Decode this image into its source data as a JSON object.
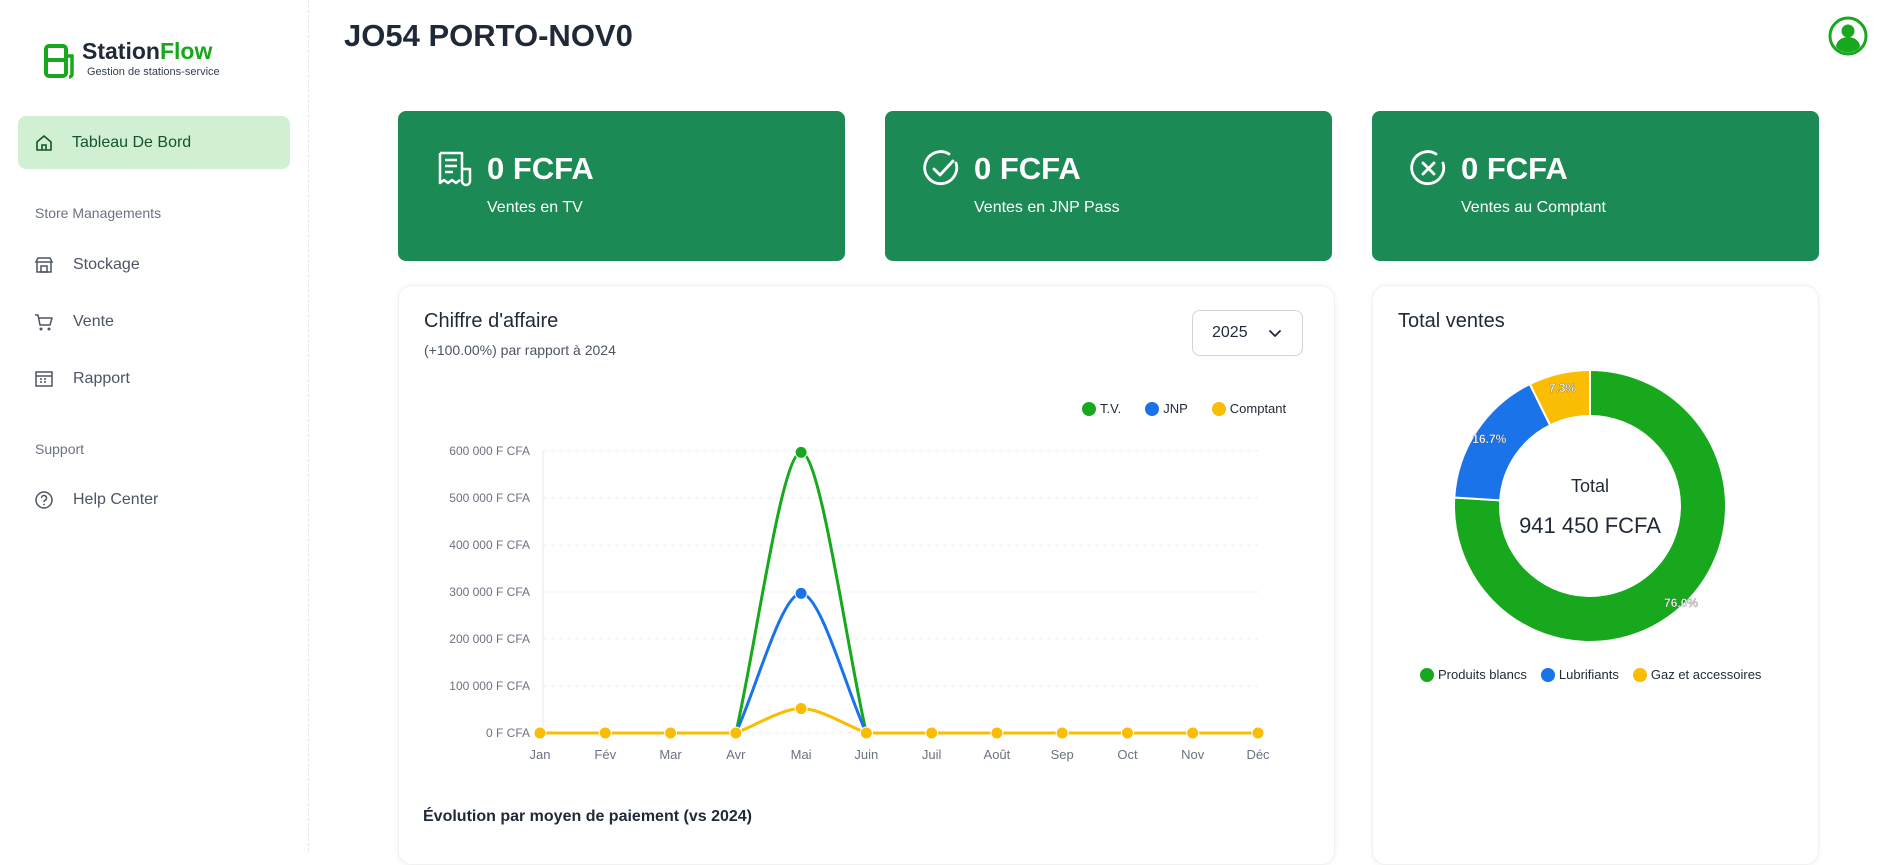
{
  "app": {
    "brand_part1": "Station",
    "brand_part2": "Flow",
    "tagline": "Gestion de stations-service"
  },
  "sidebar": {
    "active_item": {
      "label": "Tableau De Bord",
      "icon": "home-icon"
    },
    "sections": [
      {
        "label": "Store Managements"
      },
      {
        "label": "Support"
      }
    ],
    "items": [
      {
        "label": "Stockage",
        "icon": "store-icon"
      },
      {
        "label": "Vente",
        "icon": "cart-icon"
      },
      {
        "label": "Rapport",
        "icon": "report-icon"
      },
      {
        "label": "Help Center",
        "icon": "help-icon"
      }
    ]
  },
  "header": {
    "title": "JO54 PORTO-NOV0",
    "avatar_icon": "user-avatar-icon"
  },
  "kpis": [
    {
      "value": "0 FCFA",
      "label": "Ventes en TV",
      "icon": "receipt-icon"
    },
    {
      "value": "0 FCFA",
      "label": "Ventes en JNP Pass",
      "icon": "check-circle-icon"
    },
    {
      "value": "0 FCFA",
      "label": "Ventes au Comptant",
      "icon": "x-circle-icon"
    }
  ],
  "revenue_card": {
    "title": "Chiffre d'affaire",
    "subtitle": "(+100.00%) par rapport à 2024",
    "year": "2025",
    "footer": "Évolution par moyen de paiement (vs 2024)"
  },
  "total_card": {
    "title": "Total ventes",
    "center_label": "Total",
    "center_value": "941 450 FCFA"
  },
  "colors": {
    "primary": "#1b8a55",
    "tv": "#18a81d",
    "jnp": "#1a73e8",
    "comptant": "#fbbc04",
    "active_bg": "#d1f0d3"
  },
  "chart_data": [
    {
      "type": "line",
      "categories": [
        "Jan",
        "Fév",
        "Mar",
        "Avr",
        "Mai",
        "Juin",
        "Juil",
        "Août",
        "Sep",
        "Oct",
        "Nov",
        "Déc"
      ],
      "series": [
        {
          "name": "T.V.",
          "values": [
            0,
            0,
            0,
            0,
            597000,
            0,
            0,
            0,
            0,
            0,
            0,
            0
          ],
          "color": "#18a81d"
        },
        {
          "name": "JNP",
          "values": [
            0,
            0,
            0,
            0,
            297000,
            0,
            0,
            0,
            0,
            0,
            0,
            0
          ],
          "color": "#1a73e8"
        },
        {
          "name": "Comptant",
          "values": [
            0,
            0,
            0,
            0,
            52000,
            0,
            0,
            0,
            0,
            0,
            0,
            0
          ],
          "color": "#fbbc04"
        }
      ],
      "y_ticks": [
        "0 F CFA",
        "100 000 F CFA",
        "200 000 F CFA",
        "300 000 F CFA",
        "400 000 F CFA",
        "500 000 F CFA",
        "600 000 F CFA"
      ],
      "ylim": [
        0,
        600000
      ],
      "grid": true,
      "legend": "top-right"
    },
    {
      "type": "pie",
      "categories": [
        "Produits blancs",
        "Lubrifiants",
        "Gaz et accessoires"
      ],
      "values": [
        76.0,
        16.7,
        7.3
      ],
      "labels": [
        "76.0%",
        "16.7%",
        "7.3%"
      ],
      "colors": [
        "#18a81d",
        "#1a73e8",
        "#fbbc04"
      ],
      "donut": true,
      "legend": "bottom"
    }
  ]
}
